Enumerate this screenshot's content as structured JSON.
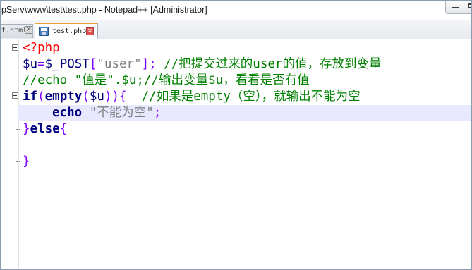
{
  "window": {
    "title": "ppServ\\www\\test\\test.php - Notepad++ [Administrator]"
  },
  "tabs": [
    {
      "label": "t.html",
      "active": false
    },
    {
      "label": "test.php",
      "active": true
    }
  ],
  "icons": {
    "tab_close": "close-icon",
    "tab_save": "save-icon",
    "minimize": "minimize-icon",
    "maximize": "maximize-icon"
  },
  "colors": {
    "php_tag": "#ff0000",
    "variable": "#000080",
    "operator": "#8000ff",
    "string": "#808080",
    "comment": "#008000",
    "current_line": "#e8e8ff",
    "active_tab_accent": "#f0a030"
  },
  "code": {
    "line1": {
      "open_tag": "<?php"
    },
    "line2": {
      "var": "$u",
      "assign": "=",
      "global": "$_POST",
      "bracket_open": "[",
      "key": "\"user\"",
      "bracket_close": "];",
      "comment": " //把提交过来的user的值，存放到变量"
    },
    "line3": {
      "comment": "//echo \"值是\".$u;//输出变量$u，看看是否有值"
    },
    "line4": {
      "keyword": "if",
      "paren_open": "(",
      "func": "empty",
      "inner_open": "(",
      "var": "$u",
      "paren_close": "))",
      "brace": "{",
      "comment": "  //如果是empty（空），就输出不能为空"
    },
    "line5": {
      "keyword": "echo",
      "string": "\"不能为空\"",
      "semicolon": ";"
    },
    "line6": {
      "brace_close": "}",
      "keyword": "else",
      "brace_open": "{"
    },
    "line7": {
      "text": ""
    },
    "line8": {
      "brace_close": "}"
    }
  }
}
